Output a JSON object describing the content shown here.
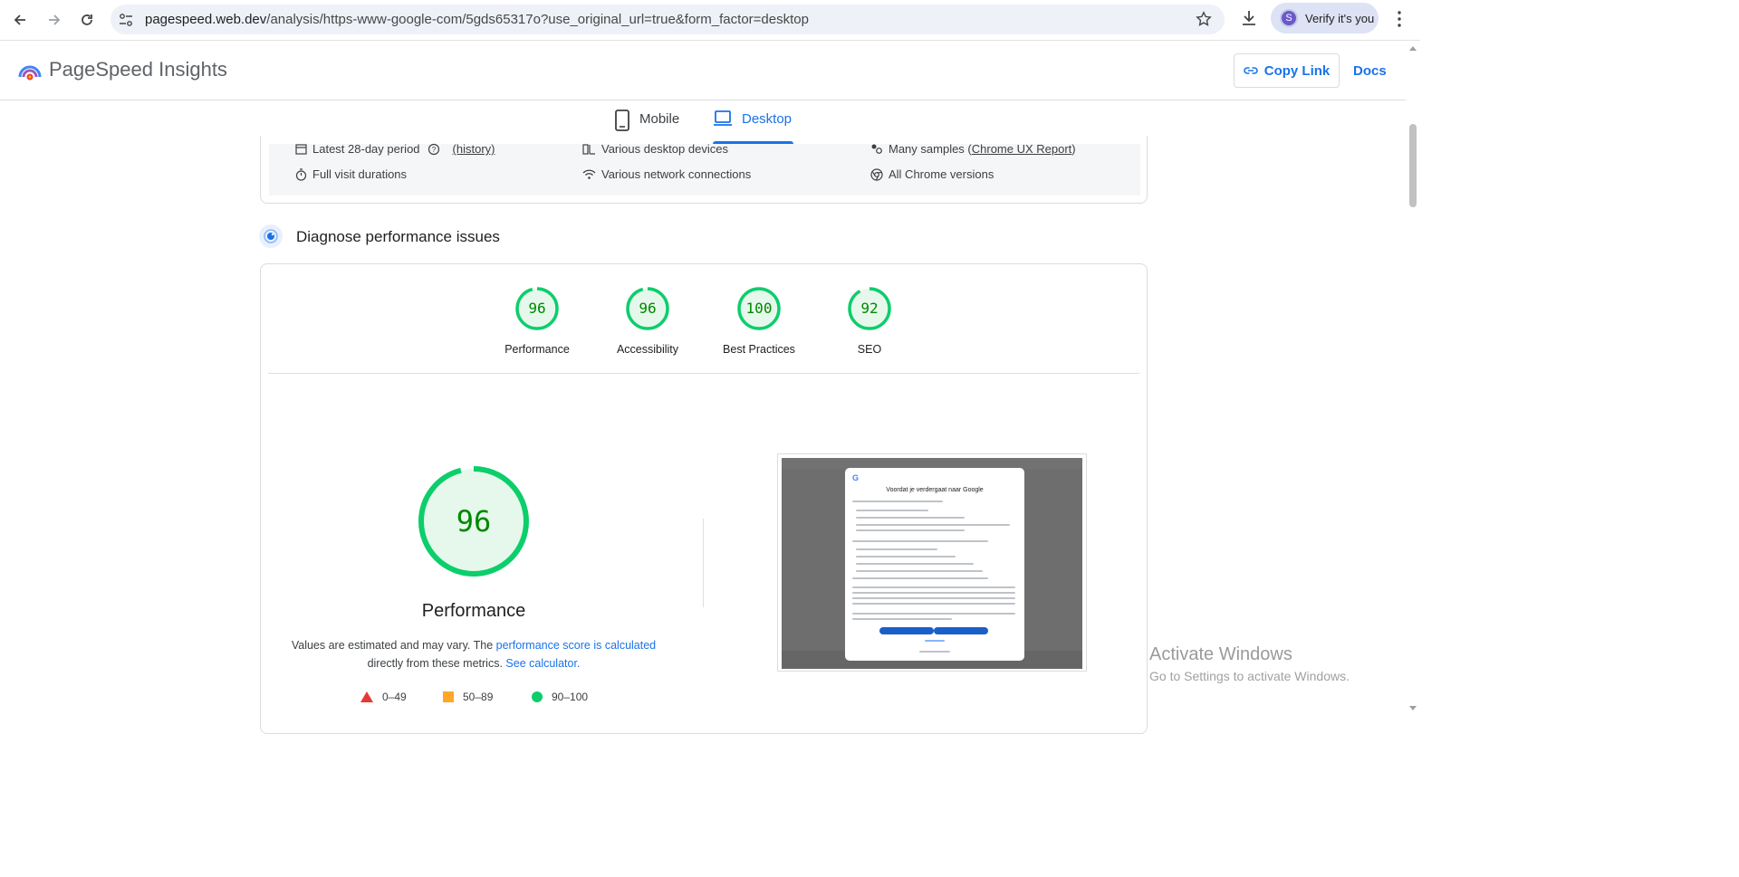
{
  "browser": {
    "url_host": "pagespeed.web.dev",
    "url_path": "/analysis/https-www-google-com/5gds65317o?use_original_url=true&form_factor=desktop",
    "profile_label": "Verify it's you",
    "profile_initial": "S"
  },
  "header": {
    "brand": "PageSpeed Insights",
    "copy_link": "Copy Link",
    "docs": "Docs"
  },
  "tabs": {
    "mobile": "Mobile",
    "desktop": "Desktop",
    "active": "Desktop"
  },
  "field_info": {
    "period": "Latest 28-day period",
    "history": "(history)",
    "devices": "Various desktop devices",
    "samples_prefix": "Many samples (",
    "samples_link": "Chrome UX Report",
    "samples_suffix": ")",
    "durations": "Full visit durations",
    "network": "Various network connections",
    "versions": "All Chrome versions"
  },
  "diagnose": {
    "title": "Diagnose performance issues"
  },
  "scores": [
    {
      "label": "Performance",
      "value": "96"
    },
    {
      "label": "Accessibility",
      "value": "96"
    },
    {
      "label": "Best Practices",
      "value": "100"
    },
    {
      "label": "SEO",
      "value": "92"
    }
  ],
  "performance": {
    "score": "96",
    "label": "Performance",
    "note_1": "Values are estimated and may vary. The ",
    "note_link_1": "performance score is calculated",
    "note_2": "directly from these metrics.",
    "note_link_2": "See calculator."
  },
  "legend": [
    {
      "range": "0–49",
      "color": "#e53935"
    },
    {
      "range": "50–89",
      "color": "#ffa726"
    },
    {
      "range": "90–100",
      "color": "#0cce6b"
    }
  ],
  "screenshot": {
    "dialog_title": "Voordat je verdergaat naar Google"
  },
  "watermark": {
    "line1": "Activate Windows",
    "line2": "Go to Settings to activate Windows."
  },
  "colors": {
    "accent": "#1a73e8",
    "pass": "#0cce6b",
    "pass_text": "#008800"
  }
}
